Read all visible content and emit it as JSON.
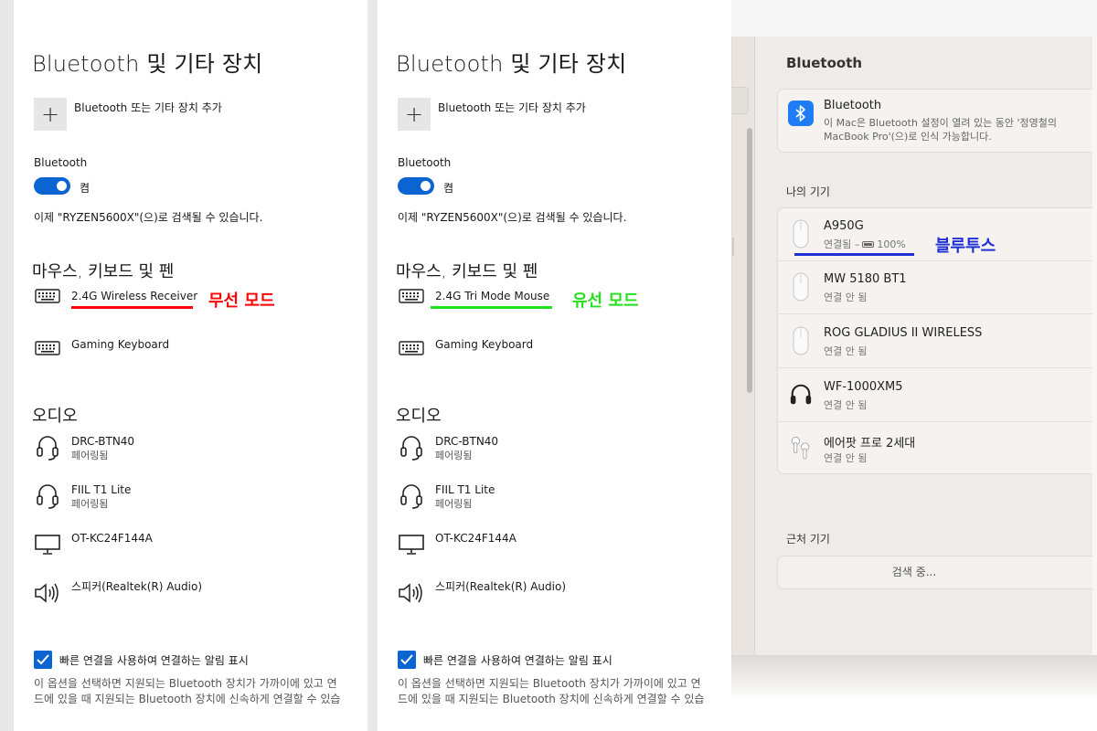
{
  "windows_panels": [
    {
      "title": "Bluetooth 및 기타 장치",
      "add_device_label": "Bluetooth 또는 기타 장치 추가",
      "bluetooth_label": "Bluetooth",
      "toggle_state": "켬",
      "discoverable_text": "이제 \"RYZEN5600X\"(으)로 검색될 수 있습니다.",
      "section_input": "마우스, 키보드 및 펜",
      "input_devices": [
        {
          "name": "2.4G Wireless Receiver",
          "icon": "keyboard-icon"
        },
        {
          "name": "Gaming Keyboard",
          "icon": "keyboard-icon"
        }
      ],
      "annotation": {
        "text": "무선 모드",
        "color": "#ff0000"
      },
      "section_audio": "오디오",
      "audio_devices": [
        {
          "name": "DRC-BTN40",
          "status": "페어링됨",
          "icon": "headset-icon"
        },
        {
          "name": "FIIL T1 Lite",
          "status": "페어링됨",
          "icon": "headset-icon"
        },
        {
          "name": "OT-KC24F144A",
          "status": "",
          "icon": "monitor-icon"
        },
        {
          "name": "스피커(Realtek(R) Audio)",
          "status": "",
          "icon": "speaker-icon"
        }
      ],
      "checkbox_label": "빠른 연결을 사용하여 연결하는 알림 표시",
      "description_line1": "이 옵션을 선택하면 지원되는 Bluetooth 장치가 가까이에 있고 연",
      "description_line2": "드에 있을 때 지원되는 Bluetooth 장치에 신속하게 연결할 수 있습"
    },
    {
      "title": "Bluetooth 및 기타 장치",
      "add_device_label": "Bluetooth 또는 기타 장치 추가",
      "bluetooth_label": "Bluetooth",
      "toggle_state": "켬",
      "discoverable_text": "이제 \"RYZEN5600X\"(으)로 검색될 수 있습니다.",
      "section_input": "마우스, 키보드 및 펜",
      "input_devices": [
        {
          "name": "2.4G Tri Mode Mouse",
          "icon": "keyboard-icon"
        },
        {
          "name": "Gaming Keyboard",
          "icon": "keyboard-icon"
        }
      ],
      "annotation": {
        "text": "유선 모드",
        "color": "#22e01a"
      },
      "section_audio": "오디오",
      "audio_devices": [
        {
          "name": "DRC-BTN40",
          "status": "페어링됨",
          "icon": "headset-icon"
        },
        {
          "name": "FIIL T1 Lite",
          "status": "페어링됨",
          "icon": "headset-icon"
        },
        {
          "name": "OT-KC24F144A",
          "status": "",
          "icon": "monitor-icon"
        },
        {
          "name": "스피커(Realtek(R) Audio)",
          "status": "",
          "icon": "speaker-icon"
        }
      ],
      "checkbox_label": "빠른 연결을 사용하여 연결하는 알림 표시",
      "description_line1": "이 옵션을 선택하면 지원되는 Bluetooth 장치가 가까이에 있고 연",
      "description_line2": "드에 있을 때 지원되는 Bluetooth 장치에 신속하게 연결할 수 있습"
    }
  ],
  "mac": {
    "title": "Bluetooth",
    "bt_title": "Bluetooth",
    "bt_desc": "이 Mac은 Bluetooth 설정이 열려 있는 동안 '정영철의 MacBook Pro'(으)로 인식 가능합니다.",
    "my_devices_label": "나의 기기",
    "devices": [
      {
        "name": "A950G",
        "status_prefix": "연결됨 –",
        "battery": "100%",
        "icon": "mouse-icon"
      },
      {
        "name": "MW 5180 BT1",
        "status": "연결 안 됨",
        "icon": "mouse-icon"
      },
      {
        "name": "ROG GLADIUS II WIRELESS",
        "status": "연결 안 됨",
        "icon": "mouse-icon"
      },
      {
        "name": "WF-1000XM5",
        "status": "연결 안 됨",
        "icon": "headphones-icon"
      },
      {
        "name": "에어팟 프로 2세대",
        "status": "연결 안 됨",
        "icon": "airpods-icon"
      }
    ],
    "annotation": {
      "text": "블루투스",
      "color": "#1f2fd6"
    },
    "nearby_label": "근처 기기",
    "searching_label": "검색 중..."
  }
}
